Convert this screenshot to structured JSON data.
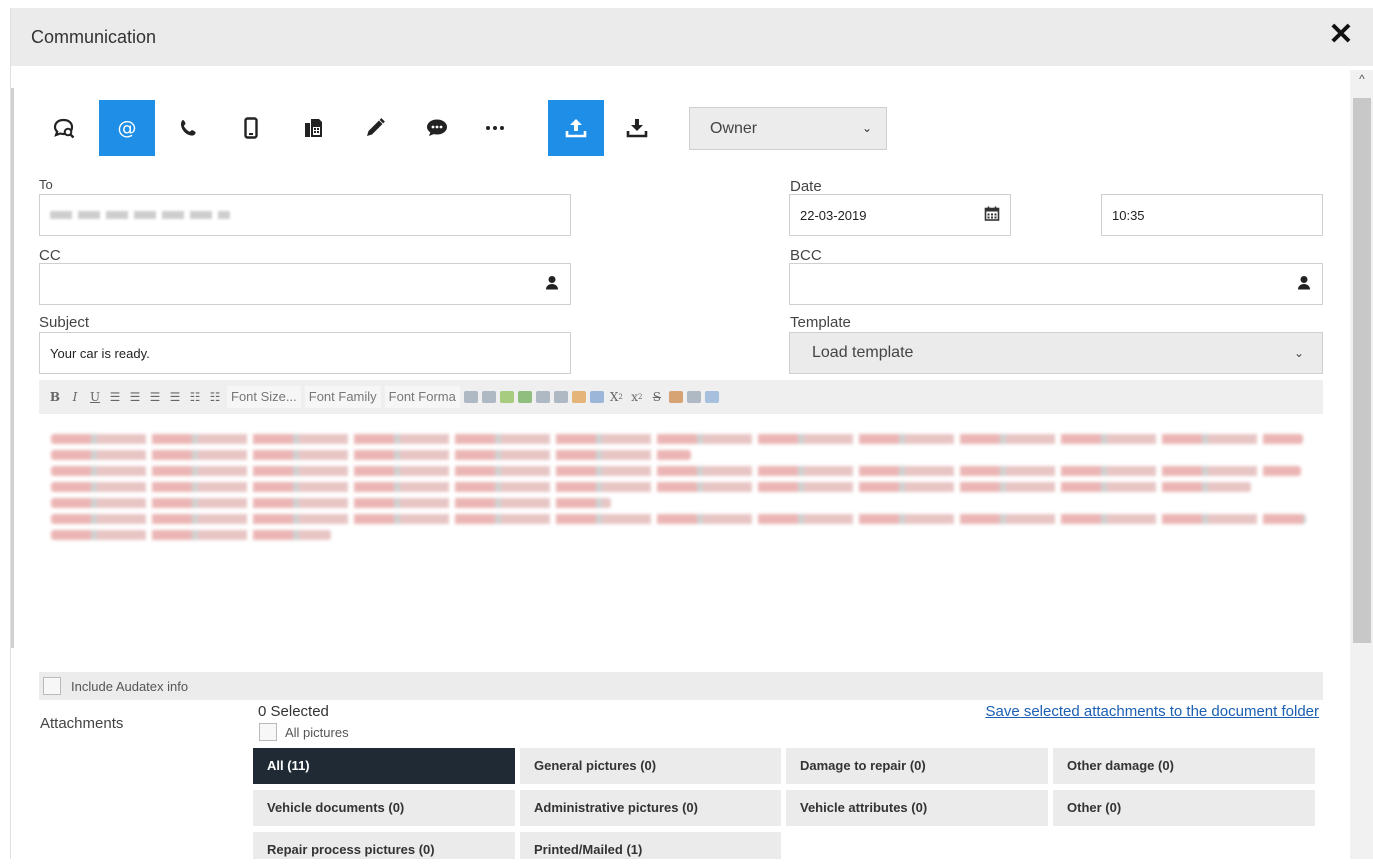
{
  "window": {
    "title": "Communication"
  },
  "toolbar": {
    "icons": [
      "chat-search-icon",
      "email-icon",
      "phone-icon",
      "mobile-icon",
      "fax-icon",
      "pencil-icon",
      "message-icon",
      "more-icon",
      "upload-icon",
      "download-icon"
    ],
    "active": [
      "email-icon",
      "upload-icon"
    ],
    "recipient_select": "Owner"
  },
  "form": {
    "to_label": "To",
    "date_label": "Date",
    "date_value": "22-03-2019",
    "time_value": "10:35",
    "cc_label": "CC",
    "bcc_label": "BCC",
    "subject_label": "Subject",
    "subject_value": "Your car is ready.",
    "template_label": "Template",
    "template_value": "Load template"
  },
  "editor": {
    "bold": "B",
    "italic": "I",
    "underline": "U",
    "font_size": "Font Size...",
    "font_family": "Font Family",
    "font_format": "Font Forma",
    "subscript": "X",
    "superscript": "x"
  },
  "options": {
    "include_audatex_label": "Include Audatex info"
  },
  "attachments": {
    "label": "Attachments",
    "selected_count": "0 Selected",
    "all_pictures_label": "All pictures",
    "save_link": "Save selected attachments to the document folder",
    "categories": [
      "All (11)",
      "General pictures (0)",
      "Damage to repair (0)",
      "Other damage (0)",
      "Vehicle documents (0)",
      "Administrative pictures (0)",
      "Vehicle attributes (0)",
      "Other (0)",
      "Repair process pictures (0)",
      "Printed/Mailed (1)"
    ],
    "active_category": "All (11)"
  },
  "colors": {
    "accent": "#1f8ee6",
    "active_category_bg": "#1f2a34"
  }
}
